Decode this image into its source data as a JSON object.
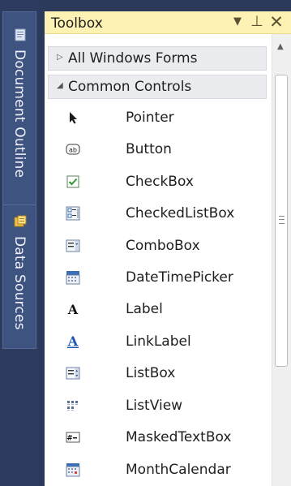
{
  "side_tabs": [
    {
      "label": "Document Outline",
      "icon": "document-outline-icon"
    },
    {
      "label": "Data Sources",
      "icon": "data-sources-icon"
    }
  ],
  "toolbox": {
    "title": "Toolbox",
    "buttons": {
      "dropdown": "▼",
      "pin": "⊥",
      "close": "✕"
    },
    "groups": [
      {
        "label": "All Windows Forms",
        "expanded": false
      },
      {
        "label": "Common Controls",
        "expanded": true
      }
    ],
    "items": [
      {
        "label": "Pointer",
        "icon": "pointer-icon"
      },
      {
        "label": "Button",
        "icon": "button-icon"
      },
      {
        "label": "CheckBox",
        "icon": "checkbox-icon"
      },
      {
        "label": "CheckedListBox",
        "icon": "checkedlistbox-icon"
      },
      {
        "label": "ComboBox",
        "icon": "combobox-icon"
      },
      {
        "label": "DateTimePicker",
        "icon": "datetimepicker-icon"
      },
      {
        "label": "Label",
        "icon": "label-icon"
      },
      {
        "label": "LinkLabel",
        "icon": "linklabel-icon"
      },
      {
        "label": "ListBox",
        "icon": "listbox-icon"
      },
      {
        "label": "ListView",
        "icon": "listview-icon"
      },
      {
        "label": "MaskedTextBox",
        "icon": "maskedtextbox-icon"
      },
      {
        "label": "MonthCalendar",
        "icon": "monthcalendar-icon"
      }
    ]
  },
  "colors": {
    "title_bar": "#fdf1b4",
    "side_strip": "#2d3c5e",
    "side_tab": "#3f5380",
    "link_blue": "#1f56b3"
  }
}
